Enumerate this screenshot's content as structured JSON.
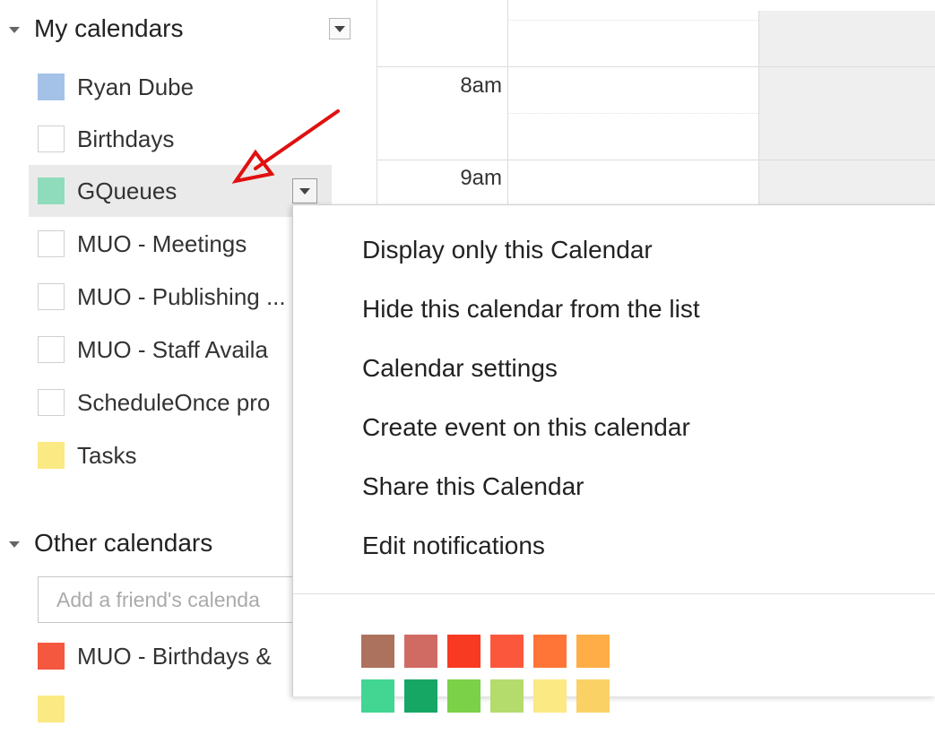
{
  "my_calendars": {
    "title": "My calendars",
    "items": [
      {
        "label": "Ryan Dube",
        "color": "#a4c2e7",
        "checked": true
      },
      {
        "label": "Birthdays",
        "color": "",
        "checked": false
      },
      {
        "label": "GQueues",
        "color": "#8fdcbc",
        "checked": true,
        "selected": true
      },
      {
        "label": "MUO - Meetings",
        "color": "",
        "checked": false
      },
      {
        "label": "MUO - Publishing ...",
        "color": "",
        "checked": false
      },
      {
        "label": "MUO - Staff Availa",
        "color": "",
        "checked": false
      },
      {
        "label": "ScheduleOnce pro",
        "color": "",
        "checked": false
      },
      {
        "label": "Tasks",
        "color": "#fbe983",
        "checked": true
      }
    ]
  },
  "other_calendars": {
    "title": "Other calendars",
    "add_placeholder": "Add a friend's calenda",
    "items": [
      {
        "label": "MUO - Birthdays &",
        "color": "#f4583f",
        "checked": true
      }
    ]
  },
  "grid": {
    "hours": [
      "8am",
      "9am"
    ]
  },
  "context_menu": {
    "items": [
      "Display only this Calendar",
      "Hide this calendar from the list",
      "Calendar settings",
      "Create event on this calendar",
      "Share this Calendar",
      "Edit notifications"
    ],
    "color_rows": [
      [
        "#ac725e",
        "#d06b64",
        "#f83a22",
        "#fa573c",
        "#ff7537",
        "#ffad46"
      ],
      [
        "#42d692",
        "#16a765",
        "#7bd148",
        "#b3dc6c",
        "#fbe983",
        "#fad165"
      ]
    ]
  },
  "colors": {
    "accent_arrow": "#e01010"
  }
}
